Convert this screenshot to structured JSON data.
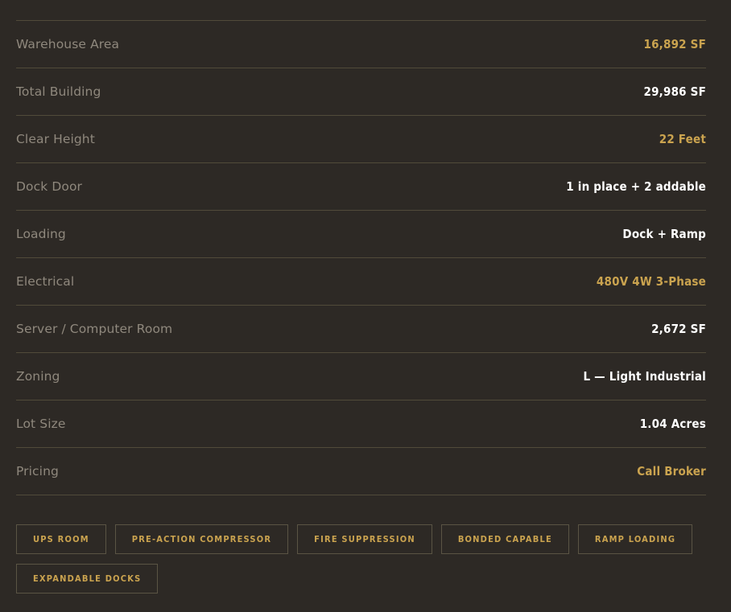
{
  "specs": [
    {
      "label": "Warehouse Area",
      "value": "16,892 SF",
      "accent": true
    },
    {
      "label": "Total Building",
      "value": "29,986 SF",
      "accent": false
    },
    {
      "label": "Clear Height",
      "value": "22 Feet",
      "accent": true
    },
    {
      "label": "Dock Door",
      "value": "1 in place + 2 addable",
      "accent": false
    },
    {
      "label": "Loading",
      "value": "Dock + Ramp",
      "accent": false
    },
    {
      "label": "Electrical",
      "value": "480V 4W 3-Phase",
      "accent": true
    },
    {
      "label": "Server / Computer Room",
      "value": "2,672 SF",
      "accent": false
    },
    {
      "label": "Zoning",
      "value": "L — Light Industrial",
      "accent": false
    },
    {
      "label": "Lot Size",
      "value": "1.04 Acres",
      "accent": false
    },
    {
      "label": "Pricing",
      "value": "Call Broker",
      "accent": true
    }
  ],
  "tags": [
    "UPS ROOM",
    "PRE-ACTION COMPRESSOR",
    "FIRE SUPPRESSION",
    "BONDED CAPABLE",
    "RAMP LOADING",
    "EXPANDABLE DOCKS"
  ],
  "colors": {
    "background": "#2d2925",
    "divider": "#514b3a",
    "label": "#8f887d",
    "value": "#ffffff",
    "accent": "#caa34f"
  }
}
